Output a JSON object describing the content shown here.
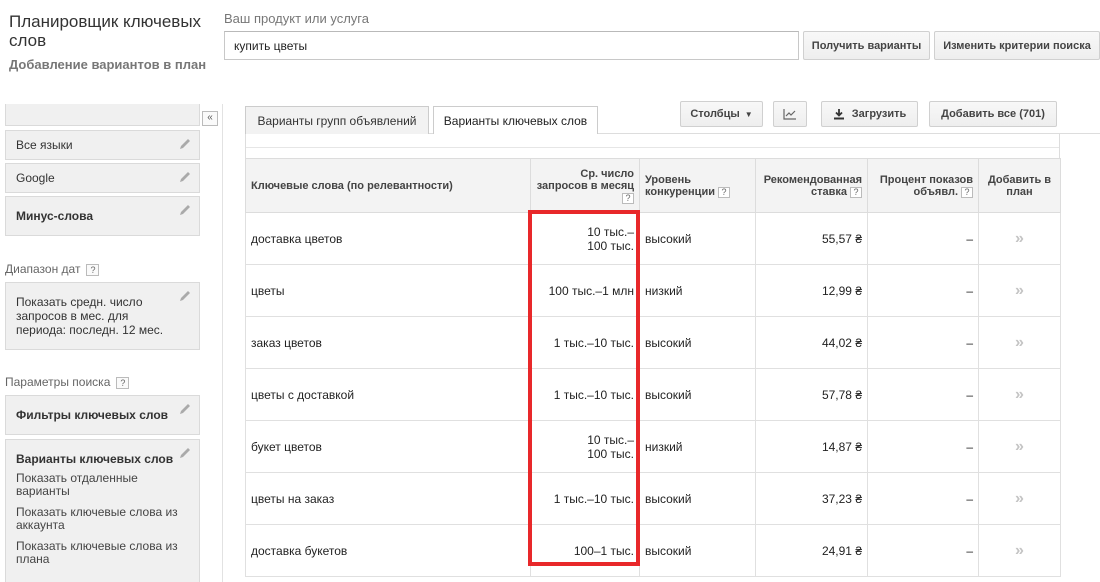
{
  "header": {
    "app_title": "Планировщик ключевых слов",
    "subtitle": "Добавление вариантов в план",
    "product_label": "Ваш продукт или услуга",
    "search_value": "купить цветы",
    "get_variants_label": "Получить варианты",
    "change_criteria_label": "Изменить критерии поиска"
  },
  "sidebar": {
    "collapse_label": "«",
    "language": "Все языки",
    "network": "Google",
    "negative_keywords": "Минус-слова",
    "date_range_label": "Диапазон дат",
    "date_range_text": "Показать средн. число запросов в мес. для периода: последн. 12 мес.",
    "search_params_label": "Параметры поиска",
    "keyword_filters": "Фильтры ключевых слов",
    "keyword_options": {
      "title": "Варианты ключевых слов",
      "items": [
        "Показать отдаленные варианты",
        "Показать ключевые слова из аккаунта",
        "Показать ключевые слова из плана"
      ]
    }
  },
  "tabs": {
    "ad_groups": "Варианты групп объявлений",
    "keywords": "Варианты ключевых слов"
  },
  "toolbar": {
    "columns_label": "Столбцы",
    "download_label": "Загрузить",
    "add_all_label": "Добавить все (701)"
  },
  "table": {
    "headers": {
      "keyword": "Ключевые слова (по релевантности)",
      "searches": "Ср. число запросов в месяц",
      "competition": "Уровень конкуренции",
      "bid": "Рекомендованная ставка",
      "impressions": "Процент показов объявл.",
      "add": "Добавить в план"
    },
    "rows": [
      {
        "keyword": "доставка цветов",
        "searches_1": "10 тыс.–",
        "searches_2": "100 тыс.",
        "competition": "высокий",
        "bid": "55,57 ₴",
        "impressions": "–",
        "add": "»"
      },
      {
        "keyword": "цветы",
        "searches_1": "100 тыс.–1 млн",
        "searches_2": "",
        "competition": "низкий",
        "bid": "12,99 ₴",
        "impressions": "–",
        "add": "»"
      },
      {
        "keyword": "заказ цветов",
        "searches_1": "1 тыс.–10 тыс.",
        "searches_2": "",
        "competition": "высокий",
        "bid": "44,02 ₴",
        "impressions": "–",
        "add": "»"
      },
      {
        "keyword": "цветы с доставкой",
        "searches_1": "1 тыс.–10 тыс.",
        "searches_2": "",
        "competition": "высокий",
        "bid": "57,78 ₴",
        "impressions": "–",
        "add": "»"
      },
      {
        "keyword": "букет цветов",
        "searches_1": "10 тыс.–",
        "searches_2": "100 тыс.",
        "competition": "низкий",
        "bid": "14,87 ₴",
        "impressions": "–",
        "add": "»"
      },
      {
        "keyword": "цветы на заказ",
        "searches_1": "1 тыс.–10 тыс.",
        "searches_2": "",
        "competition": "высокий",
        "bid": "37,23 ₴",
        "impressions": "–",
        "add": "»"
      },
      {
        "keyword": "доставка букетов",
        "searches_1": "100–1 тыс.",
        "searches_2": "",
        "competition": "высокий",
        "bid": "24,91 ₴",
        "impressions": "–",
        "add": "»"
      }
    ]
  },
  "colors": {
    "highlight": "#e8282a"
  }
}
